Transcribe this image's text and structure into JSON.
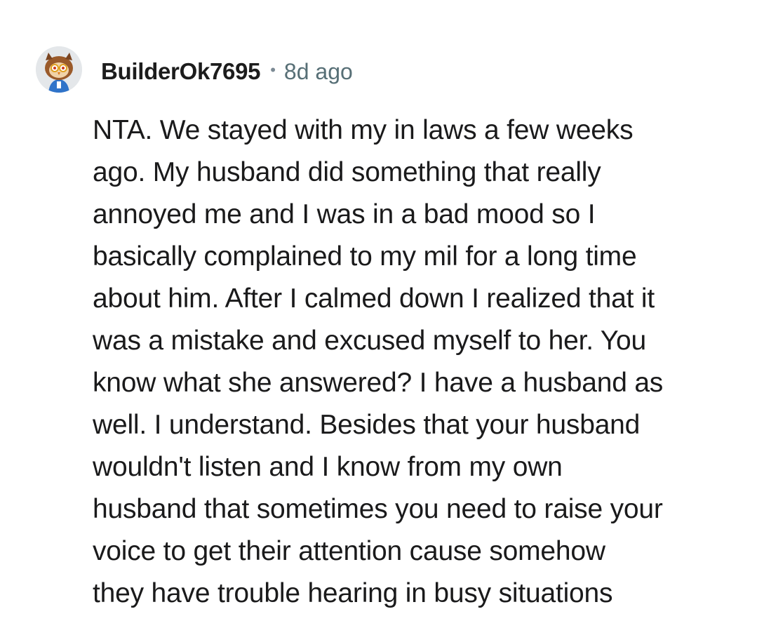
{
  "comment": {
    "author": "BuilderOk7695",
    "separator": "•",
    "timestamp": "8d ago",
    "avatar_icon": "snoo-owl-avatar-icon",
    "body_lines": [
      "NTA. We stayed with my in laws a few weeks",
      "ago. My husband did something that really",
      "annoyed me and I was in a bad mood so I",
      "basically complained to my mil for a long time",
      "about him. After I calmed down I realized that it",
      "was a mistake and excused myself to her. You",
      "know what she answered? I have a husband as",
      "well. I understand. Besides that your husband",
      "wouldn't listen and I know from my own",
      "husband that sometimes you need to raise your",
      "voice to get their attention cause somehow",
      "they have trouble hearing in busy situations"
    ]
  },
  "colors": {
    "author": "#1c1c1c",
    "meta": "#576f76",
    "body_text": "#1a1a1b",
    "background": "#ffffff"
  }
}
